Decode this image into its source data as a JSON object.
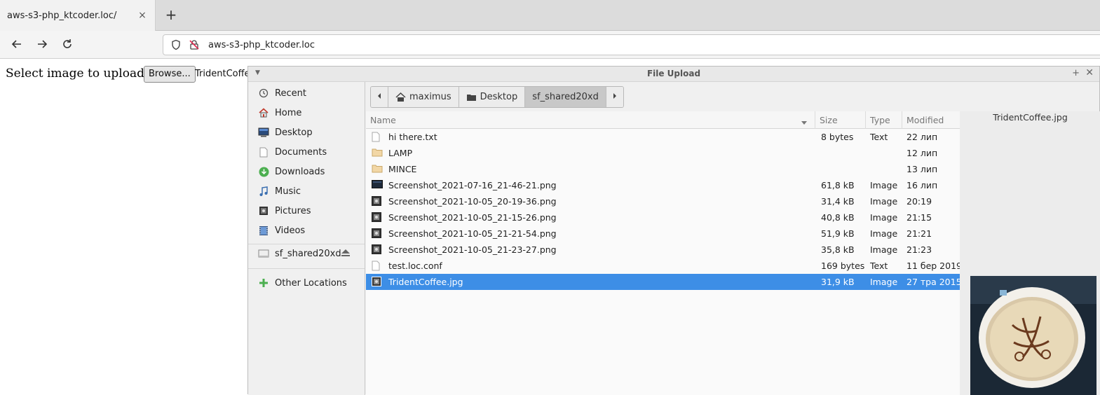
{
  "browser": {
    "tab_title": "aws-s3-php_ktcoder.loc/",
    "tab_close": "×",
    "new_tab": "+",
    "url": "aws-s3-php_ktcoder.loc"
  },
  "page": {
    "select_label": "Select image to upload:",
    "browse_label": "Browse...",
    "file_name": "TridentCoffe"
  },
  "dialog": {
    "title": "File Upload",
    "sidebar": [
      {
        "label": "Recent",
        "icon": "clock-icon"
      },
      {
        "label": "Home",
        "icon": "home-icon"
      },
      {
        "label": "Desktop",
        "icon": "desktop-icon"
      },
      {
        "label": "Documents",
        "icon": "document-icon"
      },
      {
        "label": "Downloads",
        "icon": "download-icon"
      },
      {
        "label": "Music",
        "icon": "music-icon"
      },
      {
        "label": "Pictures",
        "icon": "pictures-icon"
      },
      {
        "label": "Videos",
        "icon": "video-icon"
      },
      {
        "label": "sf_shared20xd",
        "icon": "drive-icon"
      },
      {
        "label": "Other Locations",
        "icon": "plus-icon"
      }
    ],
    "path": [
      "maximus",
      "Desktop",
      "sf_shared20xd"
    ],
    "columns": [
      "Name",
      "Size",
      "Type",
      "Modified"
    ],
    "files": [
      {
        "name": "hi there.txt",
        "size": "8 bytes",
        "type": "Text",
        "modified": "22 лип",
        "kind": "text"
      },
      {
        "name": "LAMP",
        "size": "",
        "type": "",
        "modified": "12 лип",
        "kind": "folder"
      },
      {
        "name": "MINCE",
        "size": "",
        "type": "",
        "modified": "13 лип",
        "kind": "folder"
      },
      {
        "name": "Screenshot_2021-07-16_21-46-21.png",
        "size": "61,8 kB",
        "type": "Image",
        "modified": "16 лип",
        "kind": "image-dark"
      },
      {
        "name": "Screenshot_2021-10-05_20-19-36.png",
        "size": "31,4 kB",
        "type": "Image",
        "modified": "20:19",
        "kind": "image"
      },
      {
        "name": "Screenshot_2021-10-05_21-15-26.png",
        "size": "40,8 kB",
        "type": "Image",
        "modified": "21:15",
        "kind": "image"
      },
      {
        "name": "Screenshot_2021-10-05_21-21-54.png",
        "size": "51,9 kB",
        "type": "Image",
        "modified": "21:21",
        "kind": "image"
      },
      {
        "name": "Screenshot_2021-10-05_21-23-27.png",
        "size": "35,8 kB",
        "type": "Image",
        "modified": "21:23",
        "kind": "image"
      },
      {
        "name": "test.loc.conf",
        "size": "169 bytes",
        "type": "Text",
        "modified": "11 бер 2019",
        "kind": "text"
      },
      {
        "name": "TridentCoffee.jpg",
        "size": "31,9 kB",
        "type": "Image",
        "modified": "27 тра 2015",
        "kind": "image",
        "selected": true
      }
    ],
    "preview_name": "TridentCoffee.jpg"
  },
  "colors": {
    "selection": "#3d8ee6"
  }
}
